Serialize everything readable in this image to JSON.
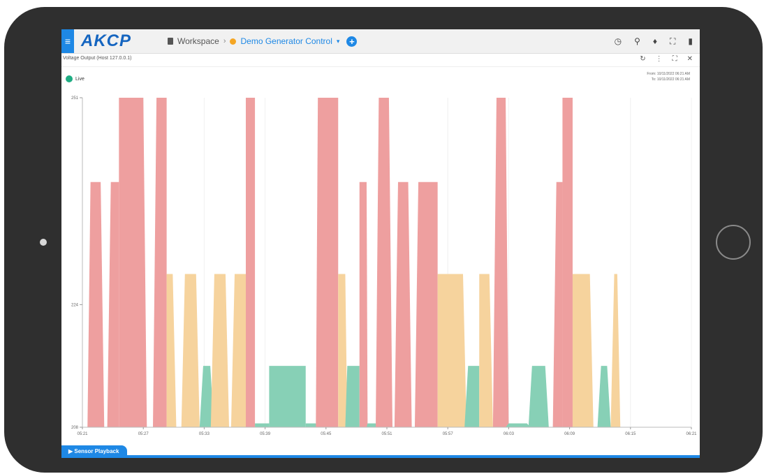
{
  "app": {
    "logo": "AKCP",
    "menu_icon": "hamburger-icon",
    "breadcrumb": {
      "workspace_label": "Workspace",
      "separator": "›",
      "dashboard_label": "Demo Generator Control",
      "caret": "▾",
      "add_label": "+"
    },
    "top_icons": [
      "◷",
      "⚲",
      "♦",
      "⛶",
      "▮"
    ]
  },
  "widget": {
    "title": "Voltage Output (Host 127.0.0.1)",
    "actions": [
      "↻",
      "⋮",
      "⛶",
      "✕"
    ],
    "live_label": "Live",
    "range_from": "From: 10/11/2022 06:21 AM",
    "range_to": "To: 10/11/2022 06:21 AM"
  },
  "playback_label": "▶ Sensor Playback",
  "colors": {
    "high": "#ee9f9f",
    "mid": "#f6d39d",
    "low": "#87d0b6",
    "accent": "#1e88e5",
    "live": "#1fad83"
  },
  "chart_data": {
    "type": "area",
    "yticks": [
      208,
      224,
      251
    ],
    "ylim": [
      208,
      251
    ],
    "xticks": [
      "05:21",
      "05:27",
      "05:33",
      "05:39",
      "05:45",
      "05:51",
      "05:57",
      "06:03",
      "06:09",
      "06:15",
      "06:21"
    ],
    "xlim_minutes": [
      0,
      60
    ],
    "levels": {
      "low": 216,
      "mid": 228,
      "high": 240
    },
    "series": [
      {
        "segments": [
          {
            "x": [
              0.8,
              1.8
            ],
            "y": "high"
          },
          {
            "x": [
              2.8,
              3.6
            ],
            "y": "high"
          },
          {
            "x": [
              3.6,
              6.0
            ],
            "y": 251
          },
          {
            "x": [
              7.3,
              8.3
            ],
            "y": 251
          },
          {
            "x": [
              8.3,
              8.9
            ],
            "y": "mid"
          },
          {
            "x": [
              10.1,
              11.2
            ],
            "y": "mid"
          },
          {
            "x": [
              11.9,
              12.6
            ],
            "y": "low"
          },
          {
            "x": [
              13.0,
              14.1
            ],
            "y": "mid"
          },
          {
            "x": [
              15.0,
              16.1
            ],
            "y": "mid"
          },
          {
            "x": [
              16.1,
              17.0
            ],
            "y": 251
          },
          {
            "x": [
              17.0,
              18.4
            ],
            "y": 208.5
          },
          {
            "x": [
              18.4,
              22.0
            ],
            "y": "low"
          },
          {
            "x": [
              22.0,
              23.0
            ],
            "y": 208.5
          },
          {
            "x": [
              23.2,
              25.2
            ],
            "y": 251
          },
          {
            "x": [
              25.2,
              25.9
            ],
            "y": "mid"
          },
          {
            "x": [
              26.1,
              27.3
            ],
            "y": "low"
          },
          {
            "x": [
              27.3,
              28.0
            ],
            "y": "high"
          },
          {
            "x": [
              28.1,
              28.9
            ],
            "y": 208.5
          },
          {
            "x": [
              29.2,
              30.2
            ],
            "y": 251
          },
          {
            "x": [
              31.1,
              32.1
            ],
            "y": "high"
          },
          {
            "x": [
              33.1,
              35.0
            ],
            "y": "high"
          },
          {
            "x": [
              35.0,
              37.5
            ],
            "y": "mid"
          },
          {
            "x": [
              38.0,
              39.1
            ],
            "y": "low"
          },
          {
            "x": [
              39.1,
              40.1
            ],
            "y": "mid"
          },
          {
            "x": [
              40.8,
              41.7
            ],
            "y": 251
          },
          {
            "x": [
              42.0,
              43.8
            ],
            "y": 208.5
          },
          {
            "x": [
              44.3,
              45.6
            ],
            "y": "low"
          },
          {
            "x": [
              46.7,
              47.3
            ],
            "y": "high"
          },
          {
            "x": [
              47.3,
              48.3
            ],
            "y": 251
          },
          {
            "x": [
              48.3,
              50.0
            ],
            "y": "mid"
          },
          {
            "x": [
              51.1,
              51.7
            ],
            "y": "low"
          },
          {
            "x": [
              52.4,
              52.7
            ],
            "y": "mid"
          }
        ]
      }
    ]
  }
}
